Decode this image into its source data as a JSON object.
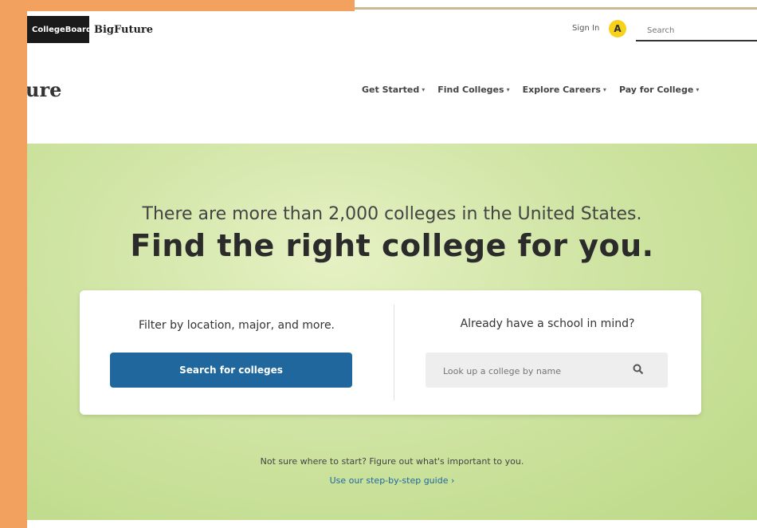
{
  "utility_bar": {
    "cb_logo_text": "CollegeBoard",
    "bp_logo_text": "BigFuture",
    "sign_in_label": "Sign In",
    "avatar_letter": "A",
    "search_placeholder": "Search"
  },
  "nav": {
    "brand": "ure",
    "items": [
      {
        "label": "Get Started"
      },
      {
        "label": "Find Colleges"
      },
      {
        "label": "Explore Careers"
      },
      {
        "label": "Pay for College"
      }
    ]
  },
  "hero": {
    "subtitle": "There are more than 2,000 colleges in the United States.",
    "title": "Find the right college for you."
  },
  "card": {
    "left_label": "Filter by location, major, and more.",
    "search_button": "Search for colleges",
    "right_label": "Already have a school in mind?",
    "lookup_placeholder": "Look up a college by name"
  },
  "footer_prompt": {
    "text": "Not sure where to start? Figure out what's important to you.",
    "link": "Use our step-by-step guide"
  },
  "colors": {
    "accent": "#1f679c",
    "frame": "#f2a15f",
    "hero_green": "#cfe4a3",
    "avatar_yellow": "#f7d11a"
  }
}
